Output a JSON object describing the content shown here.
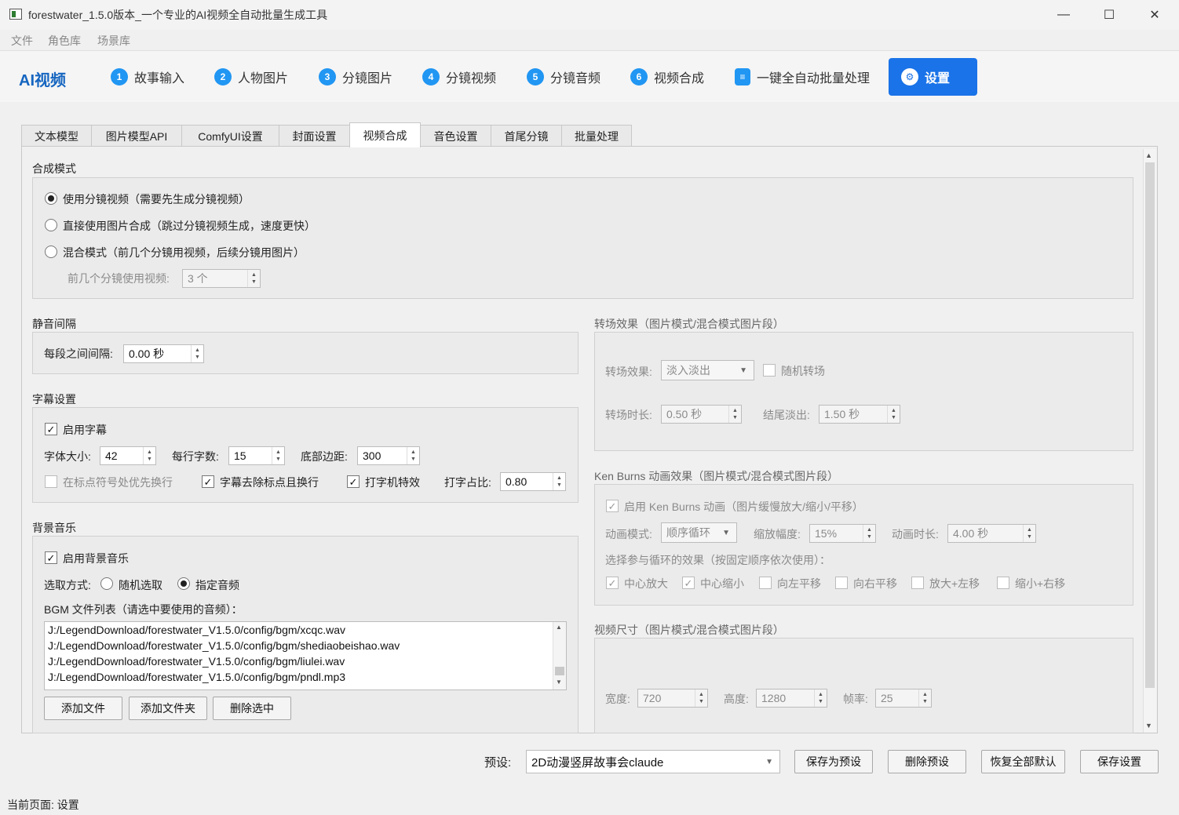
{
  "window": {
    "title": "forestwater_1.5.0版本_一个专业的AI视频全自动批量生成工具",
    "min": "—",
    "max": "☐",
    "close": "✕"
  },
  "menubar": [
    "文件",
    "角色库",
    "场景库"
  ],
  "logo": "AI视频",
  "nav": {
    "items": [
      {
        "num": "1",
        "label": "故事输入"
      },
      {
        "num": "2",
        "label": "人物图片"
      },
      {
        "num": "3",
        "label": "分镜图片"
      },
      {
        "num": "4",
        "label": "分镜视频"
      },
      {
        "num": "5",
        "label": "分镜音频"
      },
      {
        "num": "6",
        "label": "视频合成"
      }
    ],
    "batch": "一键全自动批量处理",
    "settings": "设置"
  },
  "tabs": [
    "文本模型",
    "图片模型API",
    "ComfyUI设置",
    "封面设置",
    "视频合成",
    "音色设置",
    "首尾分镜",
    "批量处理"
  ],
  "active_tab": "视频合成",
  "compose": {
    "title": "合成模式",
    "options": [
      "使用分镜视频（需要先生成分镜视频）",
      "直接使用图片合成（跳过分镜视频生成，速度更快）",
      "混合模式（前几个分镜用视频，后续分镜用图片）"
    ],
    "selected": 0,
    "first_n_label": "前几个分镜使用视频:",
    "first_n_value": "3 个"
  },
  "silence": {
    "title": "静音间隔",
    "label": "每段之间间隔:",
    "value": "0.00 秒"
  },
  "subtitle": {
    "title": "字幕设置",
    "enable_label": "启用字幕",
    "enabled": true,
    "font_size_label": "字体大小:",
    "font_size": "42",
    "chars_label": "每行字数:",
    "chars": "15",
    "margin_label": "底部边距:",
    "margin": "300",
    "punct_wrap_label": "在标点符号处优先换行",
    "strip_punct_label": "字幕去除标点且换行",
    "typewriter_label": "打字机特效",
    "ratio_label": "打字占比:",
    "ratio": "0.80"
  },
  "bgm": {
    "title": "背景音乐",
    "enable_label": "启用背景音乐",
    "mode_label": "选取方式:",
    "random_label": "随机选取",
    "specific_label": "指定音频",
    "list_label": "BGM 文件列表（请选中要使用的音频）：",
    "files": [
      "J:/LegendDownload/forestwater_V1.5.0/config/bgm/xcqc.wav",
      "J:/LegendDownload/forestwater_V1.5.0/config/bgm/shediaobeishao.wav",
      "J:/LegendDownload/forestwater_V1.5.0/config/bgm/liulei.wav",
      "J:/LegendDownload/forestwater_V1.5.0/config/bgm/pndl.mp3"
    ],
    "add_file": "添加文件",
    "add_folder": "添加文件夹",
    "remove": "删除选中"
  },
  "transition": {
    "title": "转场效果（图片模式/混合模式图片段）",
    "effect_label": "转场效果:",
    "effect_value": "淡入淡出",
    "random_label": "随机转场",
    "duration_label": "转场时长:",
    "duration": "0.50 秒",
    "fadeout_label": "结尾淡出:",
    "fadeout": "1.50 秒"
  },
  "kenburns": {
    "title": "Ken Burns 动画效果（图片模式/混合模式图片段）",
    "enable_label": "启用 Ken Burns 动画（图片缓慢放大/缩小/平移）",
    "mode_label": "动画模式:",
    "mode_value": "顺序循环",
    "scale_label": "缩放幅度:",
    "scale_value": "15%",
    "duration_label": "动画时长:",
    "duration_value": "4.00 秒",
    "select_label": "选择参与循环的效果（按固定顺序依次使用）：",
    "effects": [
      {
        "label": "中心放大",
        "checked": true
      },
      {
        "label": "中心缩小",
        "checked": true
      },
      {
        "label": "向左平移",
        "checked": false
      },
      {
        "label": "向右平移",
        "checked": false
      },
      {
        "label": "放大+左移",
        "checked": false
      },
      {
        "label": "缩小+右移",
        "checked": false
      }
    ]
  },
  "video_size": {
    "title": "视频尺寸（图片模式/混合模式图片段）",
    "width_label": "宽度:",
    "width": "720",
    "height_label": "高度:",
    "height": "1280",
    "fps_label": "帧率:",
    "fps": "25"
  },
  "footer": {
    "preset_label": "预设:",
    "preset_value": "2D动漫竖屏故事会claude",
    "save_preset": "保存为预设",
    "delete_preset": "删除预设",
    "restore": "恢复全部默认",
    "save": "保存设置"
  },
  "status": "当前页面: 设置"
}
